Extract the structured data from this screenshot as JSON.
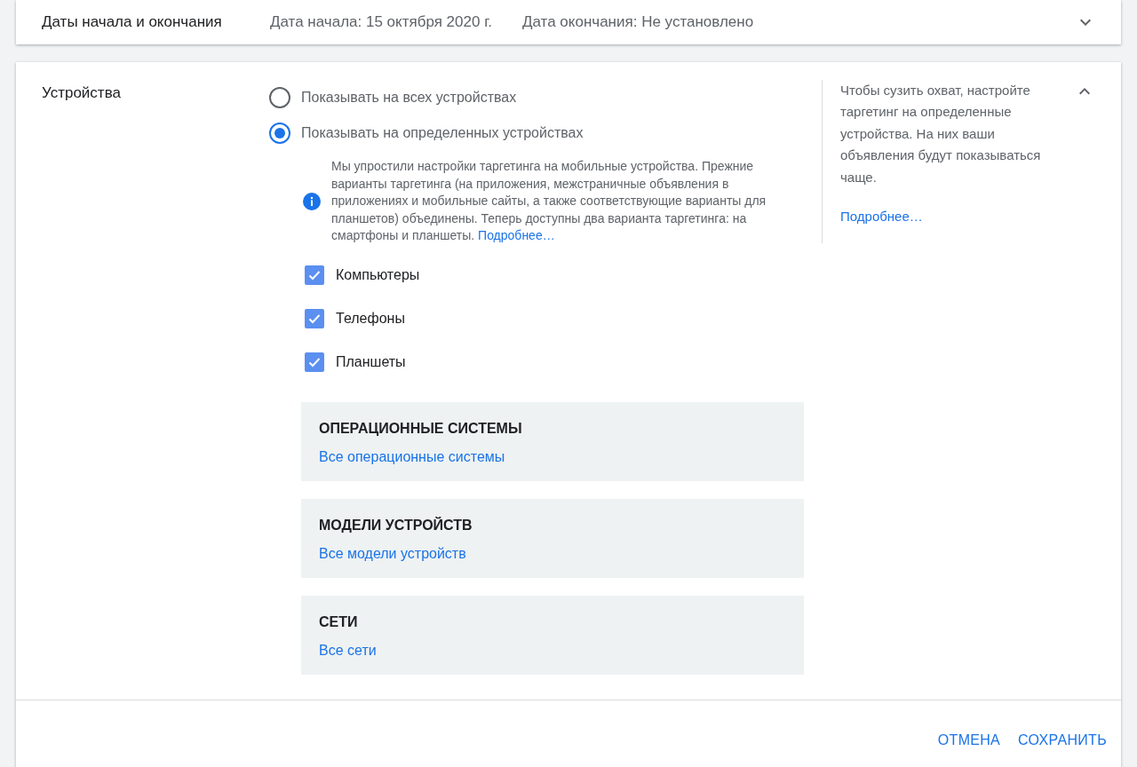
{
  "date_section": {
    "title": "Даты начала и окончания",
    "start": "Дата начала: 15 октября 2020 г.",
    "end": "Дата окончания: Не установлено",
    "expanded": false
  },
  "devices": {
    "title": "Устройства",
    "expanded": true,
    "options": [
      {
        "label": "Показывать на всех устройствах",
        "selected": false
      },
      {
        "label": "Показывать на определенных устройствах",
        "selected": true
      }
    ],
    "info": {
      "text": "Мы упростили настройки таргетинга на мобильные устройства. Прежние варианты таргетинга (на приложения, межстраничные объявления в приложениях и мобильные сайты, а также соответствующие варианты для планшетов) объединены. Теперь доступны два варианта таргетинга: на смартфоны и планшеты.",
      "link": "Подробнее…"
    },
    "checkboxes": [
      {
        "label": "Компьютеры",
        "checked": true
      },
      {
        "label": "Телефоны",
        "checked": true
      },
      {
        "label": "Планшеты",
        "checked": true
      }
    ],
    "panels": [
      {
        "title": "ОПЕРАЦИОННЫЕ СИСТЕМЫ",
        "value": "Все операционные системы"
      },
      {
        "title": "МОДЕЛИ УСТРОЙСТВ",
        "value": "Все модели устройств"
      },
      {
        "title": "СЕТИ",
        "value": "Все сети"
      }
    ],
    "help": {
      "text": "Чтобы сузить охват, настройте таргетинг на определенные устройства. На них ваши объявления будут показываться чаще.",
      "link": "Подробнее…"
    }
  },
  "footer": {
    "buttons": [
      {
        "label": "ОТМЕНА"
      },
      {
        "label": "СОХРАНИТЬ"
      }
    ]
  }
}
